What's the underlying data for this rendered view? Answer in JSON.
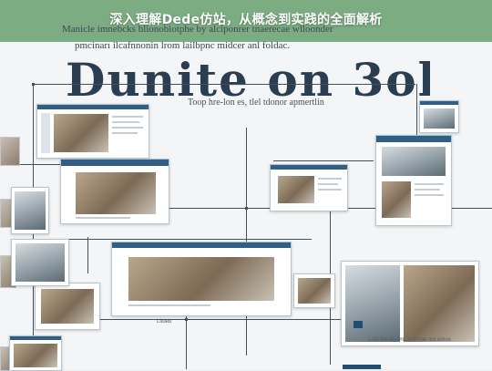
{
  "header": {
    "title": "深入理解Dede仿站，从概念到实践的全面解析"
  },
  "poster": {
    "big_heading": "Dunite on 3olooed",
    "subtitle_line1": "Manicle imnebcks blionoblotphe by alciponrer tnaerecae wlloonder",
    "subtitle_line2": "pmcinarı ilcafnnonin lrom lailbpnc midcer anl foldac.",
    "annotation": "Toop hre-lon es, tlel tdonor apmertlin",
    "captions": {
      "bottom_center": "Litdeb",
      "bottom_right": "Lctd fee de cmr-e vhcne ont emce"
    }
  },
  "colors": {
    "title_bar": "#609c68",
    "panel_header": "#2f5f87",
    "connector": "#44505b"
  }
}
